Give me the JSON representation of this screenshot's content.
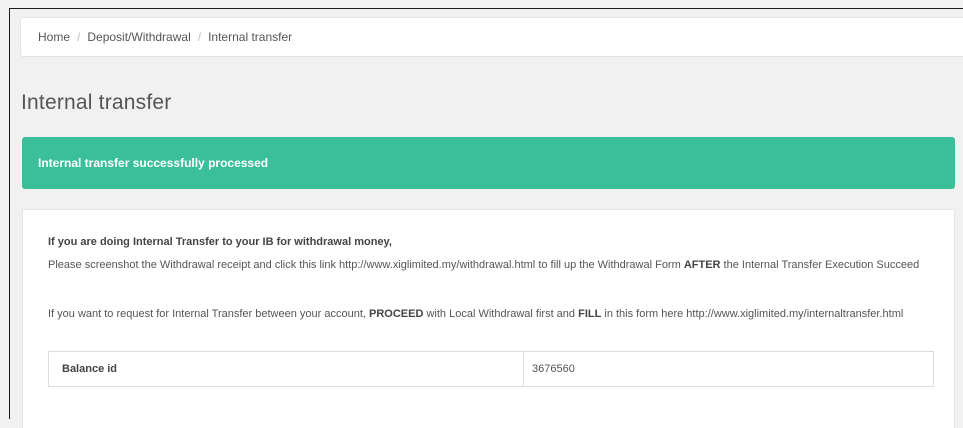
{
  "breadcrumb": {
    "items": [
      "Home",
      "Deposit/Withdrawal"
    ],
    "current": "Internal transfer",
    "separator": "/"
  },
  "page": {
    "title": "Internal transfer"
  },
  "alert": {
    "message": "Internal transfer successfully processed",
    "color": "#3bbf9a"
  },
  "info": {
    "heading": "If you are doing Internal Transfer to your IB for withdrawal money,",
    "para1": {
      "text_before_link": "Please screenshot the Withdrawal receipt and click this link ",
      "link": "http://www.xiglimited.my/withdrawal.html",
      "text_after_link": " to fill up the Withdrawal Form ",
      "emphasis": "AFTER",
      "text_end": " the Internal Transfer Execution Succeed"
    },
    "para2": {
      "text_1": "If you want to request for Internal Transfer between your account, ",
      "emphasis_1": "PROCEED",
      "text_2": " with Local Withdrawal first and ",
      "emphasis_2": "FILL",
      "text_3": " in this form here ",
      "link": "http://www.xiglimited.my/internaltransfer.html"
    }
  },
  "balance": {
    "label": "Balance id",
    "value": "3676560"
  }
}
